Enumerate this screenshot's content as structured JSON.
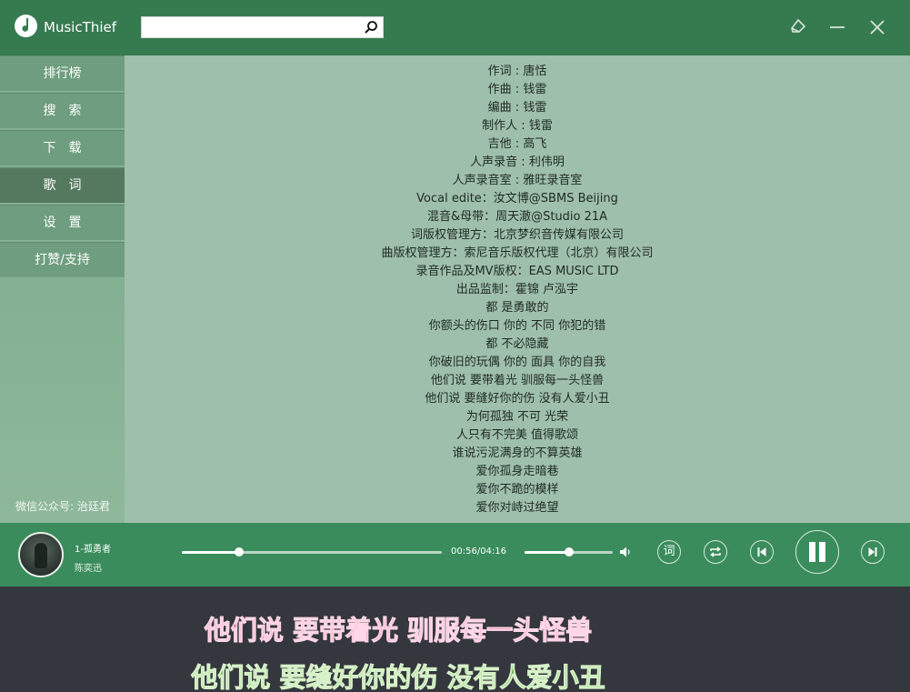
{
  "app": {
    "title": "MusicThief"
  },
  "search": {
    "value": "",
    "placeholder": ""
  },
  "window_controls": {
    "icons": [
      "skin-icon",
      "minimize-icon",
      "close-icon"
    ]
  },
  "sidebar": {
    "items": [
      {
        "label": "排行榜",
        "active": false
      },
      {
        "label": "搜　索",
        "active": false
      },
      {
        "label": "下　载",
        "active": false
      },
      {
        "label": "歌　词",
        "active": true
      },
      {
        "label": "设　置",
        "active": false
      },
      {
        "label": "打赞/支持",
        "active": false
      }
    ],
    "footer": "微信公众号: 治廷君"
  },
  "lyrics": {
    "lines": [
      "作词 : 唐恬",
      "作曲 : 钱雷",
      "编曲 : 钱雷",
      "制作人 : 钱雷",
      "吉他 : 高飞",
      "人声录音 : 利伟明",
      "人声录音室 : 雅旺录音室",
      "Vocal edite：汝文博@SBMS Beijing",
      "混音&母带：周天澈@Studio 21A",
      "词版权管理方：北京梦织音传媒有限公司",
      "曲版权管理方：索尼音乐版权代理（北京）有限公司",
      "录音作品及MV版权：EAS MUSIC LTD",
      "出品监制：霍锦 卢泓宇",
      "都 是勇敢的",
      "你额头的伤口 你的 不同 你犯的错",
      "都 不必隐藏",
      "你破旧的玩偶 你的 面具 你的自我",
      "他们说 要带着光 驯服每一头怪兽",
      "他们说 要缝好你的伤 没有人爱小丑",
      "为何孤独 不可 光荣",
      "人只有不完美 值得歌颂",
      "谁说污泥满身的不算英雄",
      "爱你孤身走暗巷",
      "爱你不跪的模样",
      "爱你对峙过绝望"
    ]
  },
  "player": {
    "song_title": "1-孤勇者",
    "artist": "陈奕迅",
    "time": "00:56/04:16",
    "progress": 0.219,
    "volume": 0.5,
    "lyric_button_label": "词",
    "accent_color": "#3a8c5c"
  },
  "desktop_lyrics": {
    "line1": "他们说 要带着光 驯服每一头怪兽",
    "line2": "他们说 要缝好你的伤 没有人爱小丑",
    "color1": "#e22f6d",
    "color2": "#55a73a"
  }
}
